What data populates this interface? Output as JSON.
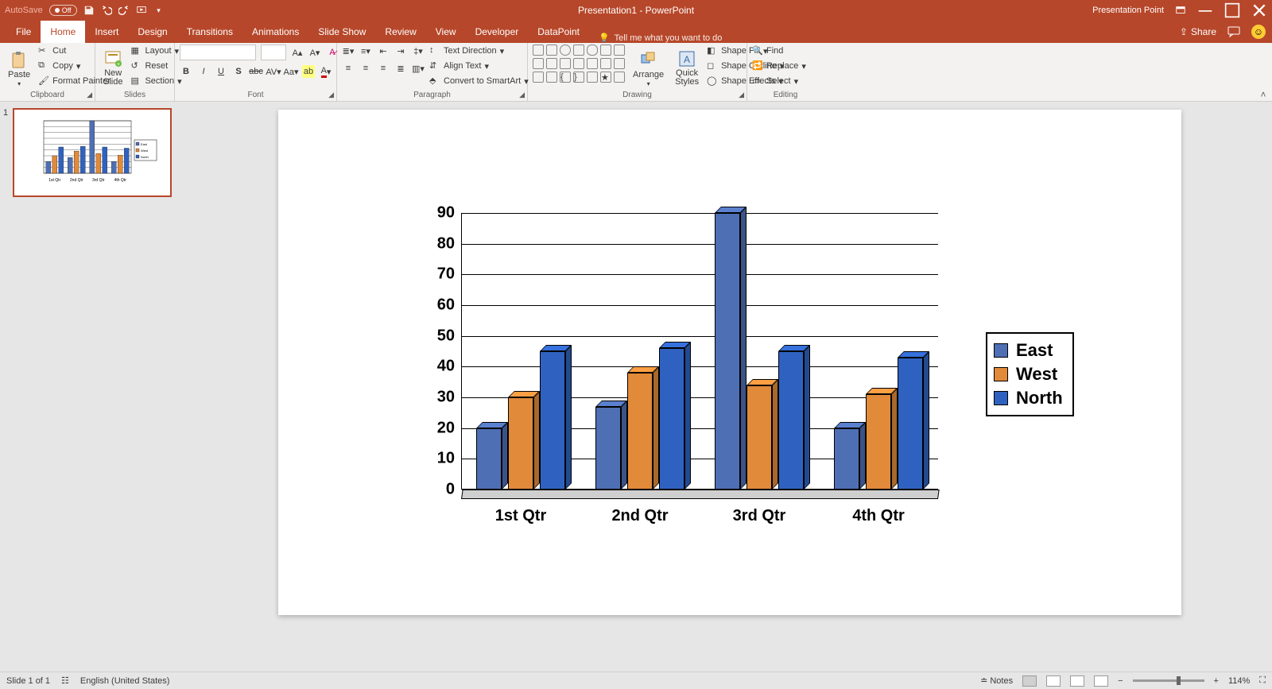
{
  "titlebar": {
    "autosave_label": "AutoSave",
    "autosave_state": "Off",
    "window_title": "Presentation1 - PowerPoint",
    "brand_link": "Presentation Point"
  },
  "tabs": {
    "items": [
      "File",
      "Home",
      "Insert",
      "Design",
      "Transitions",
      "Animations",
      "Slide Show",
      "Review",
      "View",
      "Developer",
      "DataPoint"
    ],
    "active_index": 1,
    "tell_me": "Tell me what you want to do",
    "share": "Share"
  },
  "ribbon": {
    "clipboard": {
      "group_label": "Clipboard",
      "paste": "Paste",
      "cut": "Cut",
      "copy": "Copy",
      "format_painter": "Format Painter"
    },
    "slides": {
      "group_label": "Slides",
      "new_slide": "New\nSlide",
      "layout": "Layout",
      "reset": "Reset",
      "section": "Section"
    },
    "font": {
      "group_label": "Font",
      "font_name_placeholder": "",
      "font_size_placeholder": ""
    },
    "paragraph": {
      "group_label": "Paragraph",
      "text_direction": "Text Direction",
      "align_text": "Align Text",
      "convert_smartart": "Convert to SmartArt"
    },
    "drawing": {
      "group_label": "Drawing",
      "arrange": "Arrange",
      "quick_styles": "Quick\nStyles",
      "shape_fill": "Shape Fill",
      "shape_outline": "Shape Outline",
      "shape_effects": "Shape Effects"
    },
    "editing": {
      "group_label": "Editing",
      "find": "Find",
      "replace": "Replace",
      "select": "Select"
    }
  },
  "thumbnails": {
    "slide_number": "1"
  },
  "status": {
    "slide_info": "Slide 1 of 1",
    "language": "English (United States)",
    "notes": "Notes",
    "zoom": "114%"
  },
  "chart_data": {
    "type": "bar",
    "categories": [
      "1st Qtr",
      "2nd Qtr",
      "3rd Qtr",
      "4th Qtr"
    ],
    "series": [
      {
        "name": "East",
        "color": "#4e6fb4",
        "values": [
          20,
          27,
          90,
          20
        ]
      },
      {
        "name": "West",
        "color": "#e18a3a",
        "values": [
          30,
          38,
          34,
          31
        ]
      },
      {
        "name": "North",
        "color": "#2f62c0",
        "values": [
          45,
          46,
          45,
          43
        ]
      }
    ],
    "y_ticks": [
      0,
      10,
      20,
      30,
      40,
      50,
      60,
      70,
      80,
      90
    ],
    "ylim": [
      0,
      90
    ],
    "title": "",
    "xlabel": "",
    "ylabel": ""
  }
}
